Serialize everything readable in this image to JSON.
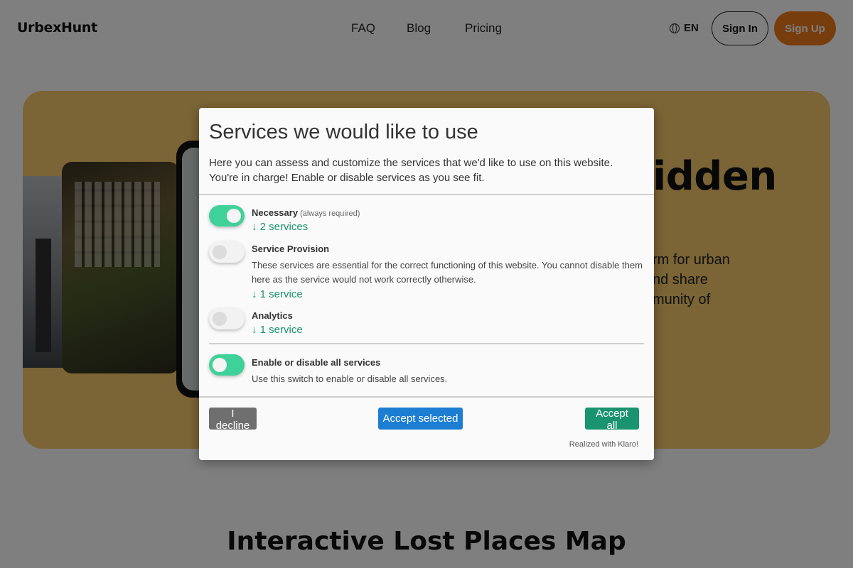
{
  "header": {
    "logo": "UrbexHunt",
    "nav": [
      "FAQ",
      "Blog",
      "Pricing"
    ],
    "language": "EN",
    "sign_in": "Sign In",
    "sign_up": "Sign Up"
  },
  "hero": {
    "title_fragment": "idden",
    "text_lines": [
      "rm for urban",
      "nd share",
      "munity of"
    ]
  },
  "section_title": "Interactive Lost Places Map",
  "consent": {
    "title": "Services we would like to use",
    "description": "Here you can assess and customize the services that we'd like to use on this website. You're in charge! Enable or disable services as you see fit.",
    "services": [
      {
        "name": "Necessary",
        "note": "(always required)",
        "enabled": true,
        "link": "↓ 2 services"
      },
      {
        "name": "Service Provision",
        "enabled": false,
        "description": "These services are essential for the correct functioning of this website. You cannot disable them here as the service would not work correctly otherwise.",
        "link": "↓ 1 service"
      },
      {
        "name": "Analytics",
        "enabled": false,
        "link": "↓ 1 service"
      }
    ],
    "all_toggle": {
      "name": "Enable or disable all services",
      "description": "Use this switch to enable or disable all services.",
      "enabled": true
    },
    "buttons": {
      "decline": "I decline",
      "accept_selected": "Accept selected",
      "accept_all": "Accept all"
    },
    "footer": "Realized with Klaro!"
  },
  "colors": {
    "accent_green": "#1a936f",
    "toggle_on": "#3fd19a",
    "accept_selected_blue": "#1c7ed3",
    "decline_gray": "#6f6f6f",
    "hero_bg": "#f7c96a",
    "sign_up_orange": "#f07a1a"
  }
}
